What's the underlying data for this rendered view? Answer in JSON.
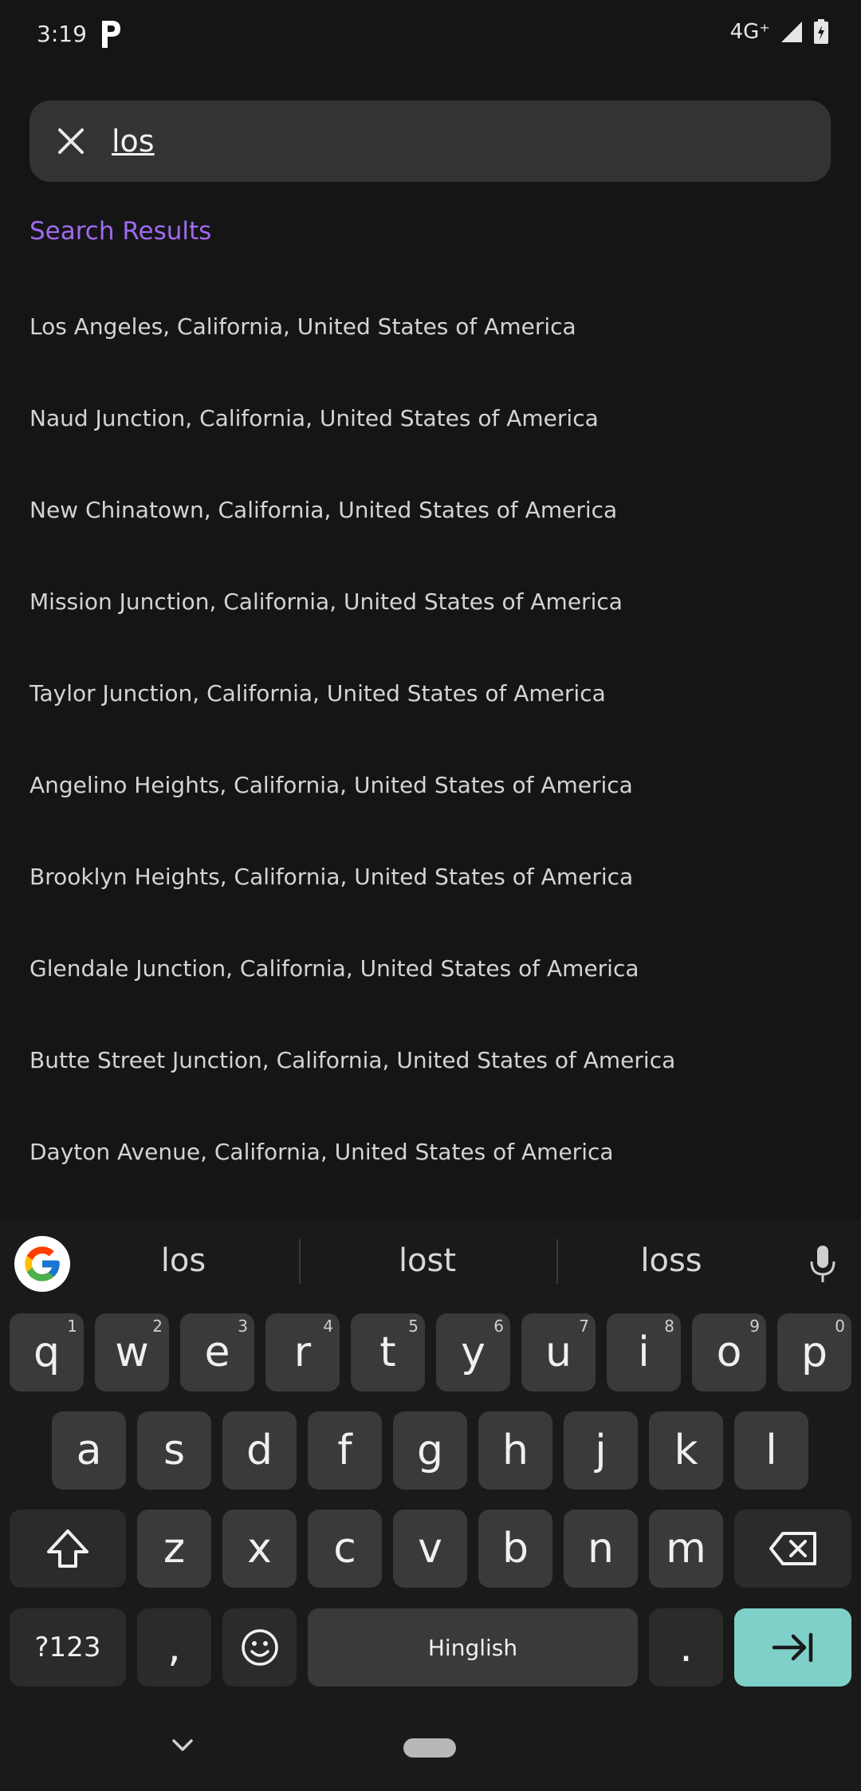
{
  "status_bar": {
    "time": "3:19",
    "network": "4G⁺"
  },
  "search": {
    "query": "los"
  },
  "results_title": "Search Results",
  "results": [
    "Los Angeles, California, United States of America",
    "Naud Junction, California, United States of America",
    "New Chinatown, California, United States of America",
    "Mission Junction, California, United States of America",
    "Taylor Junction, California, United States of America",
    "Angelino Heights, California, United States of America",
    "Brooklyn Heights, California, United States of America",
    "Glendale Junction, California, United States of America",
    "Butte Street Junction, California, United States of America",
    "Dayton Avenue, California, United States of America"
  ],
  "keyboard": {
    "suggestions": [
      "los",
      "lost",
      "loss"
    ],
    "row1": [
      {
        "k": "q",
        "h": "1"
      },
      {
        "k": "w",
        "h": "2"
      },
      {
        "k": "e",
        "h": "3"
      },
      {
        "k": "r",
        "h": "4"
      },
      {
        "k": "t",
        "h": "5"
      },
      {
        "k": "y",
        "h": "6"
      },
      {
        "k": "u",
        "h": "7"
      },
      {
        "k": "i",
        "h": "8"
      },
      {
        "k": "o",
        "h": "9"
      },
      {
        "k": "p",
        "h": "0"
      }
    ],
    "row2": [
      "a",
      "s",
      "d",
      "f",
      "g",
      "h",
      "j",
      "k",
      "l"
    ],
    "row3": [
      "z",
      "x",
      "c",
      "v",
      "b",
      "n",
      "m"
    ],
    "symbols_label": "?123",
    "comma": ",",
    "space_label": "Hinglish",
    "period": "."
  },
  "colors": {
    "accent": "#a06af0",
    "enter_key": "#7fd0c8"
  }
}
